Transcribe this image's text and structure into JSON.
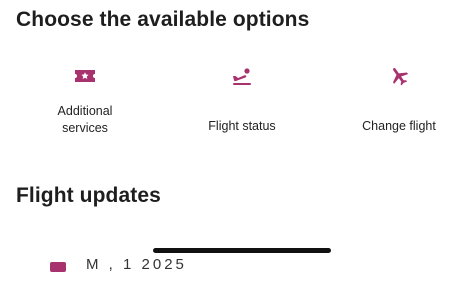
{
  "options_section": {
    "title": "Choose the available options",
    "items": [
      {
        "label_line1": "Additional",
        "label_line2": "services",
        "icon": "ticket-star-icon"
      },
      {
        "label": "Flight status",
        "icon": "plane-departure-icon"
      },
      {
        "label": "Change flight",
        "icon": "plane-icon"
      }
    ]
  },
  "updates_section": {
    "title": "Flight updates",
    "first_item_text": "M   ,  1  2025"
  },
  "colors": {
    "accent": "#a8326e",
    "text": "#1e1e1e"
  }
}
